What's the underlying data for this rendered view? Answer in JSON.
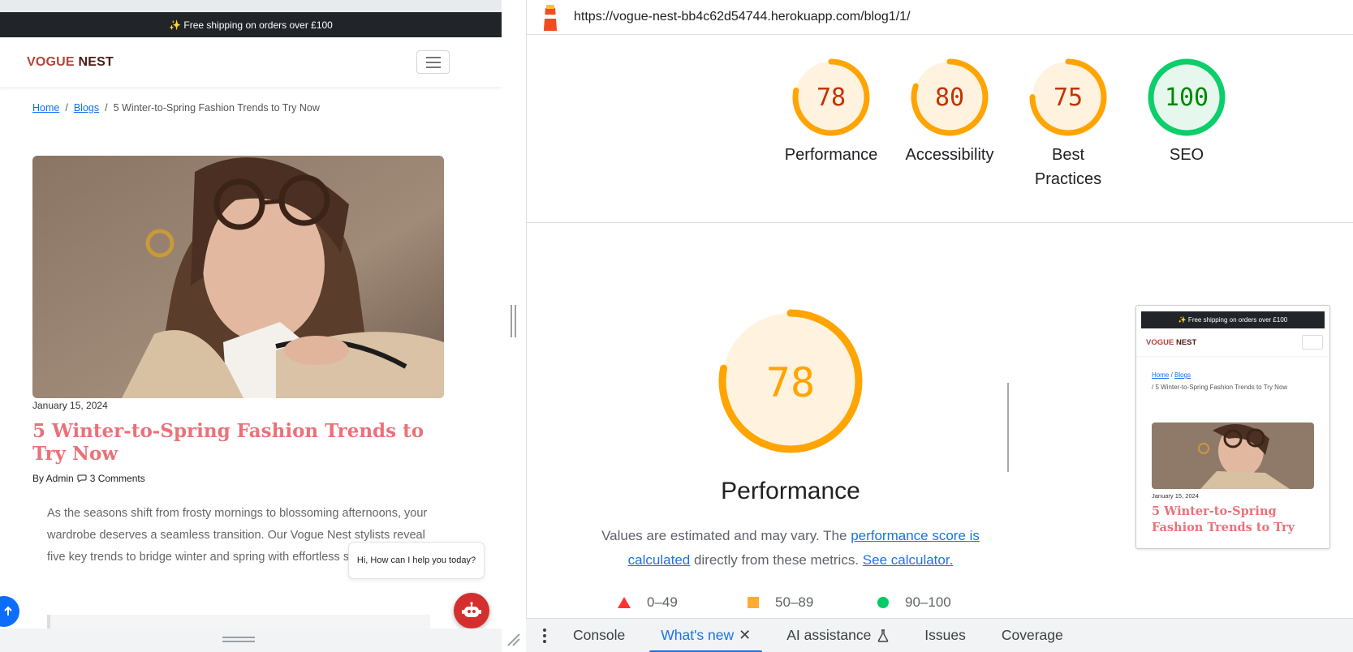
{
  "device_page": {
    "announcement": "✨ Free shipping on orders over £100",
    "brand_part1": "VOGUE",
    "brand_part2": "NEST",
    "breadcrumb": {
      "home": "Home",
      "blogs": "Blogs",
      "current": "5 Winter-to-Spring Fashion Trends to Try Now",
      "separator": "/"
    },
    "post": {
      "date": "January 15, 2024",
      "title": "5 Winter-to-Spring Fashion Trends to Try Now",
      "by": "By Admin",
      "comments": "3 Comments",
      "excerpt": "As the seasons shift from frosty mornings to blossoming afternoons, your wardrobe deserves a seamless transition. Our Vogue Nest stylists reveal five key trends to bridge winter and spring with effortless sophistication."
    },
    "chat_greeting": "Hi, How can I help you today?"
  },
  "lighthouse": {
    "url": "https://vogue-nest-bb4c62d54744.herokuapp.com/blog1/1/",
    "scores": [
      {
        "label": "Performance",
        "value": "78",
        "fraction": 0.78,
        "status": "average"
      },
      {
        "label": "Accessibility",
        "value": "80",
        "fraction": 0.8,
        "status": "average"
      },
      {
        "label": "Best Practices",
        "value": "75",
        "fraction": 0.75,
        "status": "average"
      },
      {
        "label": "SEO",
        "value": "100",
        "fraction": 1.0,
        "status": "pass"
      }
    ],
    "focus": {
      "value": "78",
      "fraction": 0.78,
      "title": "Performance",
      "desc_pre": "Values are estimated and may vary. The ",
      "desc_link1": "performance score is calculated",
      "desc_mid": " directly from these metrics. ",
      "desc_link2": "See calculator."
    },
    "legend": [
      {
        "shape": "triangle",
        "range": "0–49",
        "color": "#ff3333"
      },
      {
        "shape": "square",
        "range": "50–89",
        "color": "#ffaa33"
      },
      {
        "shape": "circle",
        "range": "90–100",
        "color": "#00cc66"
      }
    ],
    "thumbnail": {
      "announcement": "✨ Free shipping on orders over £100",
      "brand_part1": "VOGUE",
      "brand_part2": "NEST",
      "crumb_home": "Home",
      "crumb_blogs": "Blogs",
      "crumb_current": "/ 5 Winter-to-Spring Fashion Trends to Try Now",
      "date": "January 15, 2024",
      "title": "5 Winter-to-Spring Fashion Trends to Try"
    }
  },
  "colors": {
    "average": "#ffa400",
    "average_text": "#c33300",
    "average_bg": "#fff3e0",
    "pass": "#0cce6b",
    "pass_text": "#008800",
    "pass_bg": "#e6f8ee"
  },
  "drawer_tabs": [
    {
      "label": "Console"
    },
    {
      "label": "What's new"
    },
    {
      "label": "AI assistance"
    },
    {
      "label": "Issues"
    },
    {
      "label": "Coverage"
    }
  ]
}
